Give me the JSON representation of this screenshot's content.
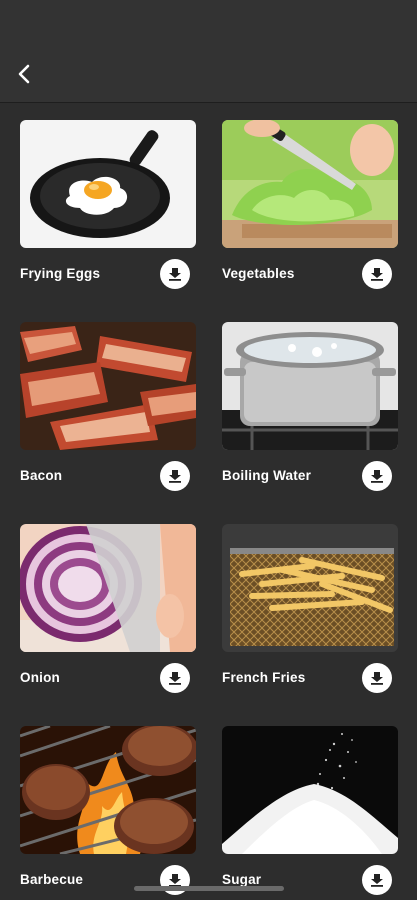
{
  "header": {
    "back_icon": "chevron-left-icon"
  },
  "items": [
    {
      "label": "Frying Eggs",
      "image": "frying-eggs-image",
      "action_icon": "download-icon"
    },
    {
      "label": "Vegetables",
      "image": "vegetables-image",
      "action_icon": "download-icon"
    },
    {
      "label": "Bacon",
      "image": "bacon-image",
      "action_icon": "download-icon"
    },
    {
      "label": "Boiling Water",
      "image": "boiling-water-image",
      "action_icon": "download-icon"
    },
    {
      "label": "Onion",
      "image": "onion-image",
      "action_icon": "download-icon"
    },
    {
      "label": "French Fries",
      "image": "french-fries-image",
      "action_icon": "download-icon"
    },
    {
      "label": "Barbecue",
      "image": "barbecue-image",
      "action_icon": "download-icon"
    },
    {
      "label": "Sugar",
      "image": "sugar-image",
      "action_icon": "download-icon"
    }
  ],
  "colors": {
    "background": "#2d2d2d",
    "header": "#333333",
    "text": "#ffffff",
    "button": "#ffffff"
  }
}
